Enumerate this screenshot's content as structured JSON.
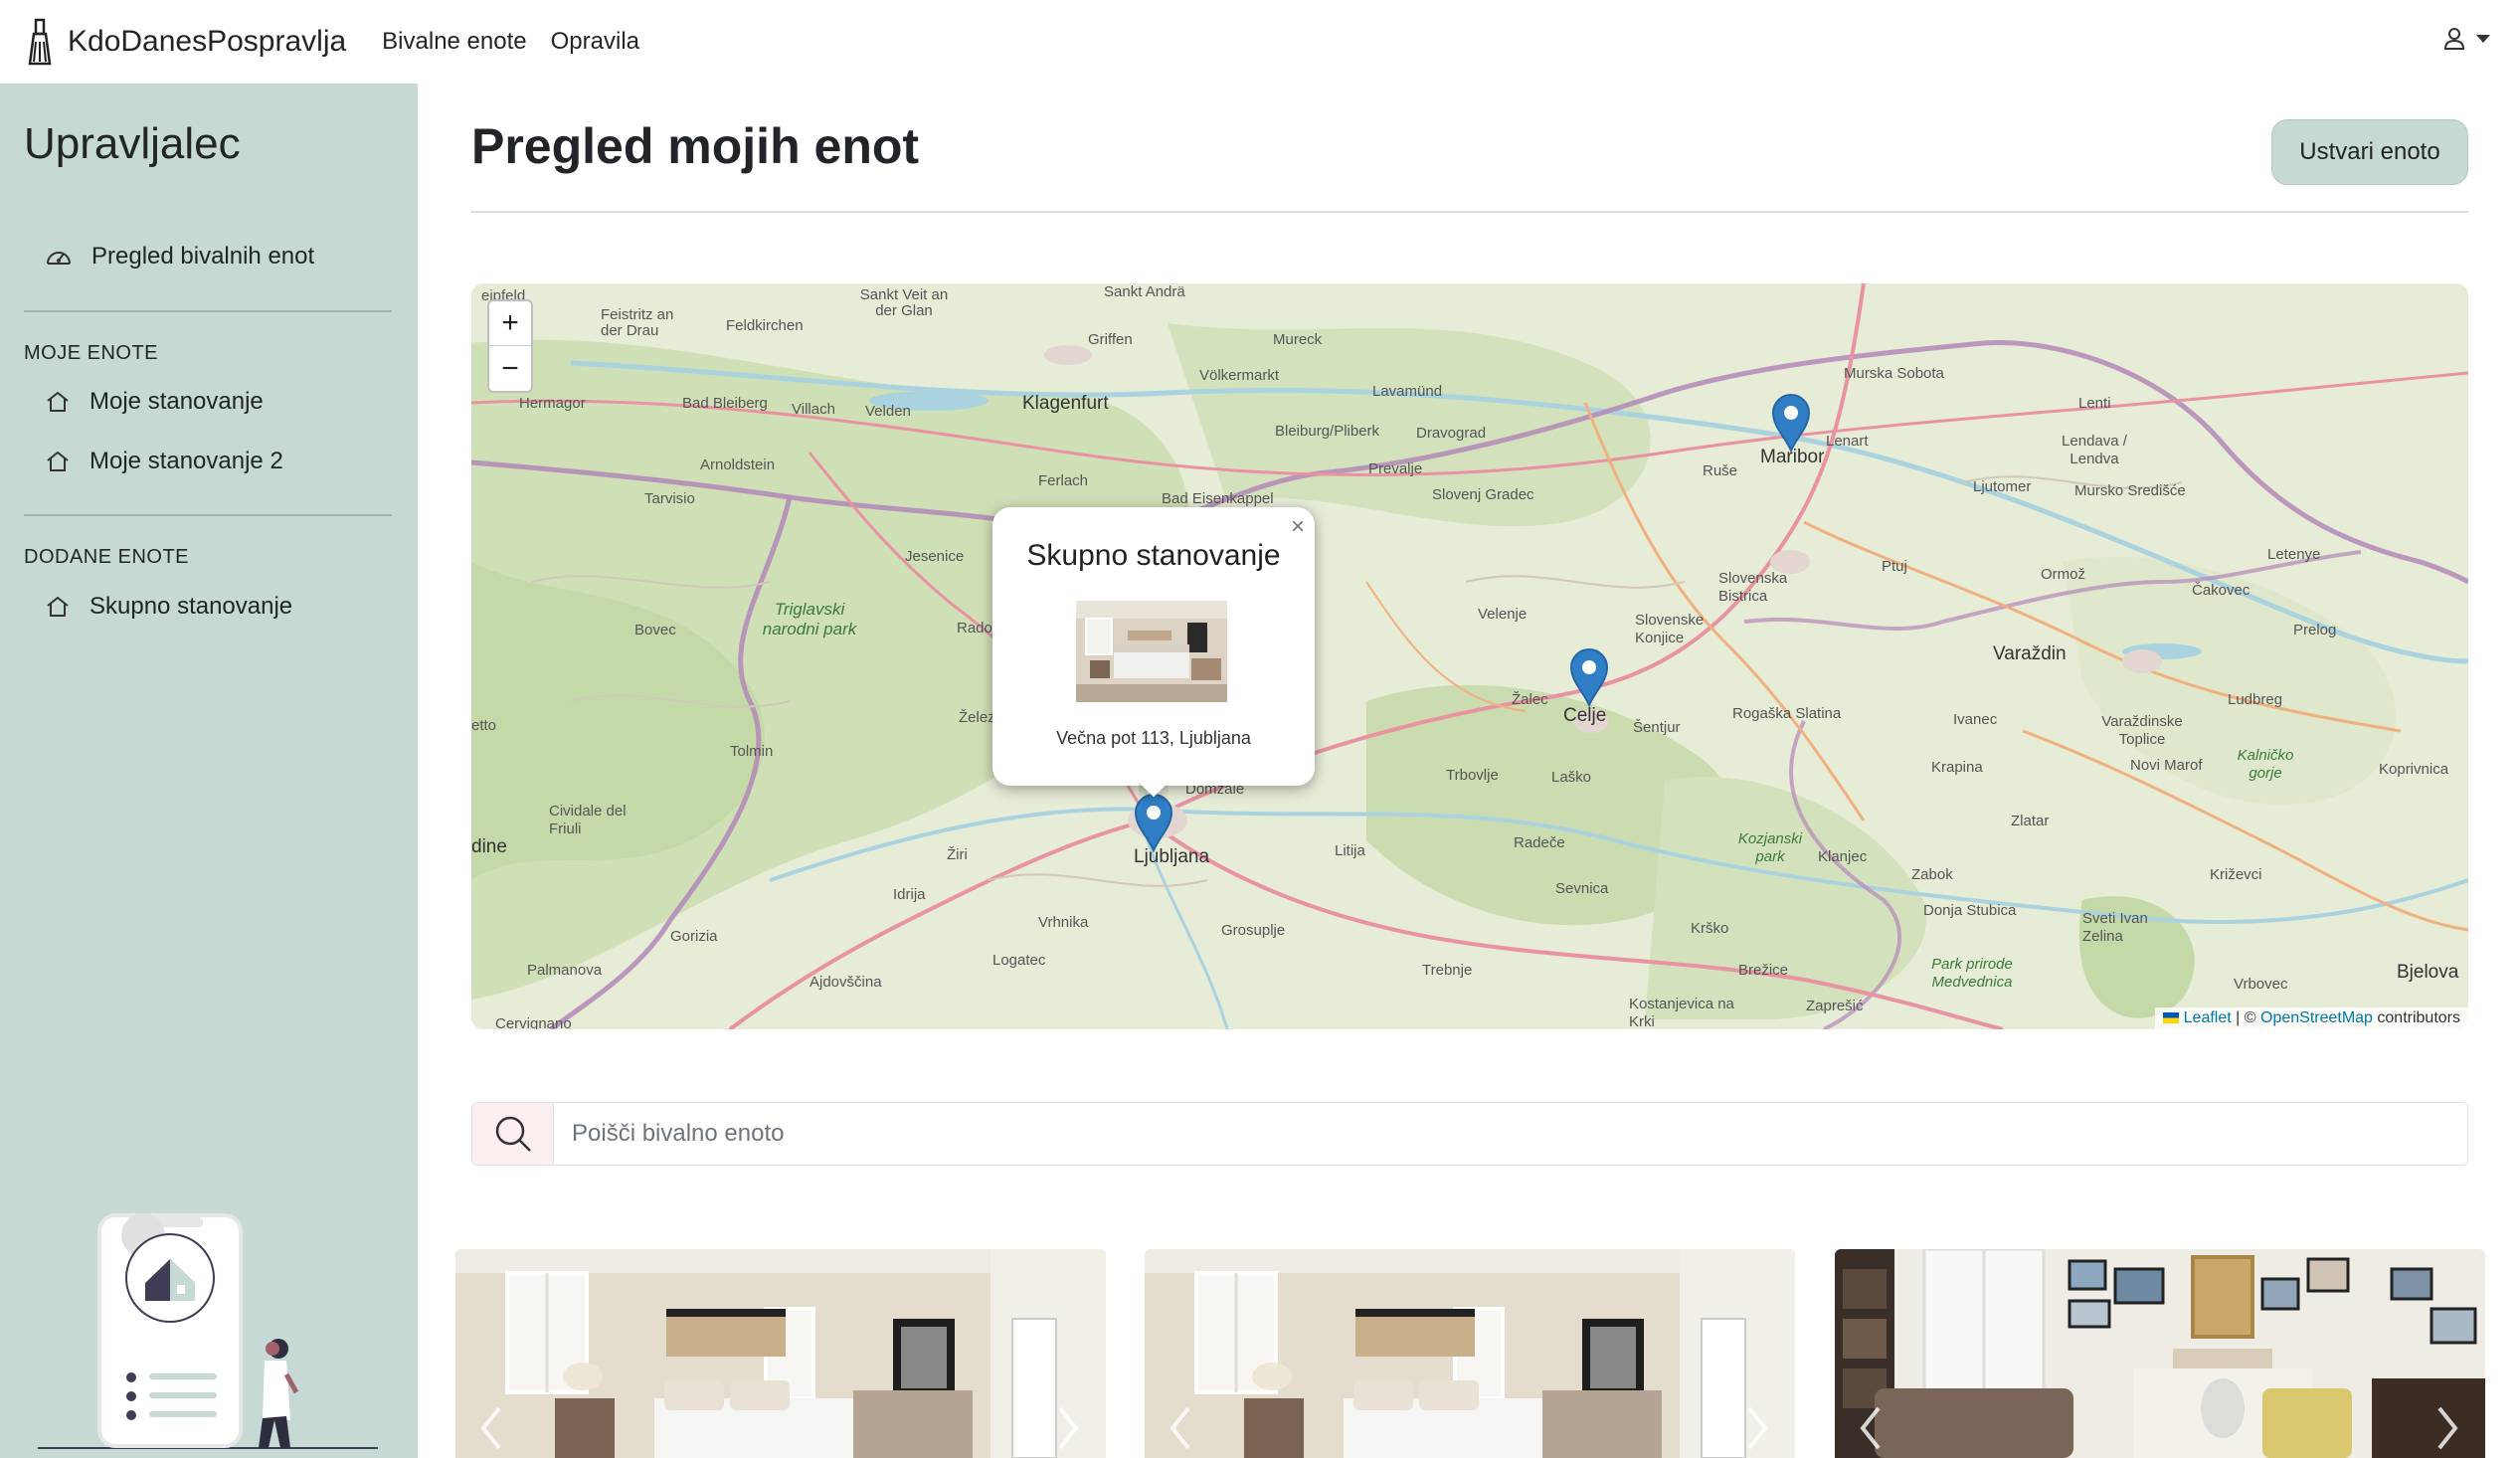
{
  "navbar": {
    "brand": "KdoDanesPospravlja",
    "links": [
      "Bivalne enote",
      "Opravila"
    ],
    "user_icon": "user-icon",
    "caret_icon": "caret-down-icon"
  },
  "sidebar": {
    "title": "Upravljalec",
    "overview": {
      "label": "Pregled bivalnih enot",
      "icon": "speedometer-icon"
    },
    "my_units": {
      "heading": "MOJE ENOTE",
      "items": [
        {
          "label": "Moje stanovanje",
          "icon": "house-icon"
        },
        {
          "label": "Moje stanovanje 2",
          "icon": "house-icon"
        }
      ]
    },
    "added_units": {
      "heading": "DODANE ENOTE",
      "items": [
        {
          "label": "Skupno stanovanje",
          "icon": "house-icon"
        }
      ]
    }
  },
  "main": {
    "title": "Pregled mojih enot",
    "create_button": "Ustvari enoto"
  },
  "map": {
    "zoom_in": "+",
    "zoom_out": "−",
    "labels": {
      "feistritz": "Feistritz an der Drau",
      "feldkirchen": "Feldkirchen",
      "sankt_veit": "Sankt Veit an der Glan",
      "sankt_andra": "Sankt Andrä",
      "griffen": "Griffen",
      "mureck": "Mureck",
      "murska_sobota": "Murska Sobota",
      "lenti": "Lenti",
      "hermagor": "Hermagor",
      "bad_bleiberg": "Bad Bleiberg",
      "villach": "Villach",
      "velden": "Velden",
      "klagenfurt": "Klagenfurt",
      "volkermarkt": "Völkermarkt",
      "lavamund": "Lavamünd",
      "lenart": "Lenart",
      "lendava": "Lendava / Lendva",
      "bleiburg": "Bleiburg/Pliberk",
      "dravograd": "Dravograd",
      "arnoldstein": "Arnoldstein",
      "prevalje": "Prevalje",
      "ruse": "Ruše",
      "maribor": "Maribor",
      "ljutomer": "Ljutomer",
      "murska_sredisce": "Mursko Središće",
      "tarvisio": "Tarvisio",
      "ferlach": "Ferlach",
      "bad_eisenkappel": "Bad Eisenkappel",
      "slovenj_gradec": "Slovenj Gradec",
      "jesenice": "Jesenice",
      "letenye": "Letenye",
      "ptuj": "Ptuj",
      "ormoz": "Ormož",
      "slovenska_bistrica": "Slovenska Bistrica",
      "cakovec": "Čakovec",
      "triglav": "Triglavski narodni park",
      "bovec": "Bovec",
      "radovljica": "Rado",
      "velenje": "Velenje",
      "slovenske_konjice": "Slovenske Konjice",
      "varazdin": "Varaždin",
      "prelog": "Prelog",
      "zalec": "Žalec",
      "celje": "Celje",
      "sentjur": "Šentjur",
      "rogaska": "Rogaška Slatina",
      "ludbreg": "Ludbreg",
      "zelezniki": "Želez",
      "ivanec": "Ivanec",
      "varazdinske_toplice": "Varaždinske Toplice",
      "kalnicko": "Kalničko gorje",
      "caporetto": "etto",
      "tolmin": "Tolmin",
      "trbovlje": "Trbovlje",
      "lasko": "Laško",
      "krapina": "Krapina",
      "novi_marof": "Novi Marof",
      "koprivnica": "Koprivnica",
      "domzale": "Domžale",
      "cividale": "Cividale del Friuli",
      "zlatar": "Zlatar",
      "udine": "dine",
      "ziri": "Žiri",
      "ljubljana": "Ljubljana",
      "litija": "Litija",
      "radece": "Radeče",
      "kozjanski": "Kozjanski park",
      "klanjec": "Klanjec",
      "zabok": "Zabok",
      "krizevci": "Križevci",
      "idrija": "Idrija",
      "sevnica": "Sevnica",
      "donja_stubica": "Donja Stubica",
      "gorizia": "Gorizia",
      "vrhnika": "Vrhnika",
      "grosuplje": "Grosuplje",
      "krsko": "Krško",
      "sveti_ivan": "Sveti Ivan Zelina",
      "logatec": "Logatec",
      "park_medvednica": "Park prirode Medvednica",
      "palmanova": "Palmanova",
      "ajdovscina": "Ajdovščina",
      "trebnje": "Trebnje",
      "brezice": "Brežice",
      "zapresic": "Zaprešić",
      "vrbovec": "Vrbovec",
      "bjelovar": "Bjelova",
      "cervignano": "Cervignano",
      "kostanjevica": "Kostanjevica na Krki"
    },
    "attribution": {
      "leaflet": "Leaflet",
      "sep": "| ©",
      "osm": "OpenStreetMap",
      "contributors": "contributors"
    },
    "popup": {
      "title": "Skupno stanovanje",
      "address": "Večna pot 113, Ljubljana",
      "close": "×"
    }
  },
  "search": {
    "placeholder": "Poišči bivalno enoto",
    "icon": "search-icon"
  },
  "cards": [
    {
      "image": "bedroom-photo"
    },
    {
      "image": "bedroom-photo"
    },
    {
      "image": "living-room-photo"
    }
  ]
}
